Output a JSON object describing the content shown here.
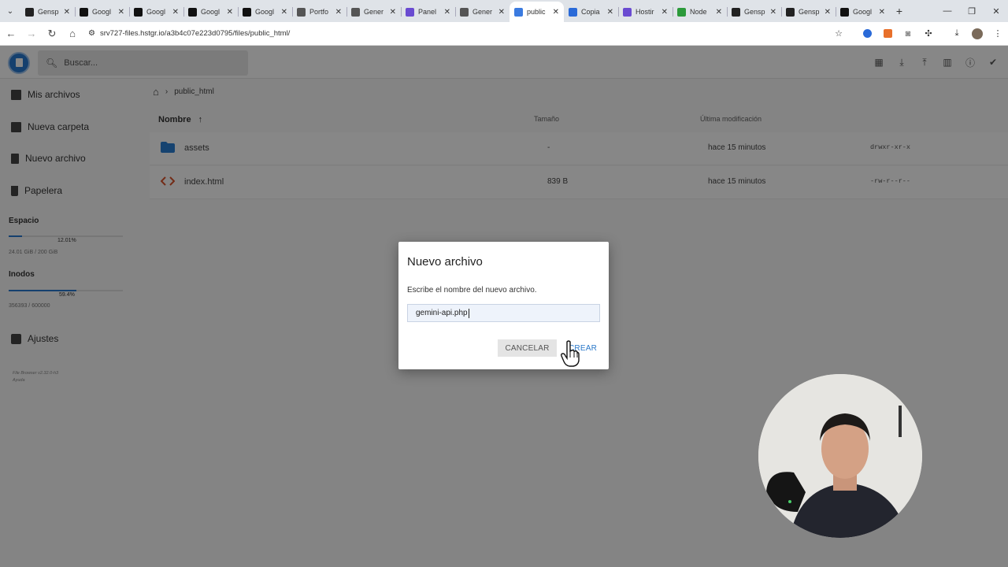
{
  "browser": {
    "tabs": [
      {
        "title": "Gensp",
        "fav_color": "#222222",
        "active": false
      },
      {
        "title": "Googl",
        "fav_color": "#111111",
        "active": false
      },
      {
        "title": "Googl",
        "fav_color": "#111111",
        "active": false
      },
      {
        "title": "Googl",
        "fav_color": "#111111",
        "active": false
      },
      {
        "title": "Googl",
        "fav_color": "#111111",
        "active": false
      },
      {
        "title": "Portfo",
        "fav_color": "#555555",
        "active": false
      },
      {
        "title": "Gener",
        "fav_color": "#555555",
        "active": false
      },
      {
        "title": "Panel",
        "fav_color": "#6a4bd1",
        "active": false
      },
      {
        "title": "Gener",
        "fav_color": "#555555",
        "active": false
      },
      {
        "title": "public",
        "fav_color": "#3b7be0",
        "active": true
      },
      {
        "title": "Copia",
        "fav_color": "#2a6ad8",
        "active": false
      },
      {
        "title": "Hostir",
        "fav_color": "#6a4bd1",
        "active": false
      },
      {
        "title": "Node",
        "fav_color": "#2c9a3b",
        "active": false
      },
      {
        "title": "Gensp",
        "fav_color": "#222222",
        "active": false
      },
      {
        "title": "Gensp",
        "fav_color": "#222222",
        "active": false
      },
      {
        "title": "Googl",
        "fav_color": "#111111",
        "active": false
      }
    ],
    "url": "srv727-files.hstgr.io/a3b4c07e223d0795/files/public_html/"
  },
  "app": {
    "search_placeholder": "Buscar...",
    "sidebar": {
      "items": [
        {
          "label": "Mis archivos",
          "icon": "folder-icon"
        },
        {
          "label": "Nueva carpeta",
          "icon": "new-folder-icon"
        },
        {
          "label": "Nuevo archivo",
          "icon": "new-file-icon"
        },
        {
          "label": "Papelera",
          "icon": "trash-icon"
        }
      ],
      "space": {
        "title": "Espacio",
        "percent_label": "12.01%",
        "fraction": 0.12,
        "usage": "24.01 GiB / 200 GiB"
      },
      "inodes": {
        "title": "Inodos",
        "percent_label": "59.4%",
        "fraction": 0.594,
        "usage": "356393 / 600000"
      },
      "settings_label": "Ajustes",
      "footer": [
        "File Browser v2.32.0-h3",
        "Ayuda"
      ]
    },
    "breadcrumb": {
      "home_icon": "home-icon",
      "folder": "public_html"
    },
    "columns": {
      "name": "Nombre",
      "size": "Tamaño",
      "modified": "Última modificación"
    },
    "files": [
      {
        "name": "assets",
        "type": "folder",
        "size": "-",
        "modified": "hace 15 minutos",
        "permissions": "drwxr-xr-x"
      },
      {
        "name": "index.html",
        "type": "code",
        "size": "839 B",
        "modified": "hace 15 minutos",
        "permissions": "-rw-r--r--"
      }
    ]
  },
  "dialog": {
    "title": "Nuevo archivo",
    "message": "Escribe el nombre del nuevo archivo.",
    "input_value": "gemini-api.php",
    "cancel_label": "CANCELAR",
    "create_label": "CREAR"
  },
  "colors": {
    "accent": "#2979d0",
    "folder": "#2a7fd4",
    "code_icon": "#d9532c"
  }
}
